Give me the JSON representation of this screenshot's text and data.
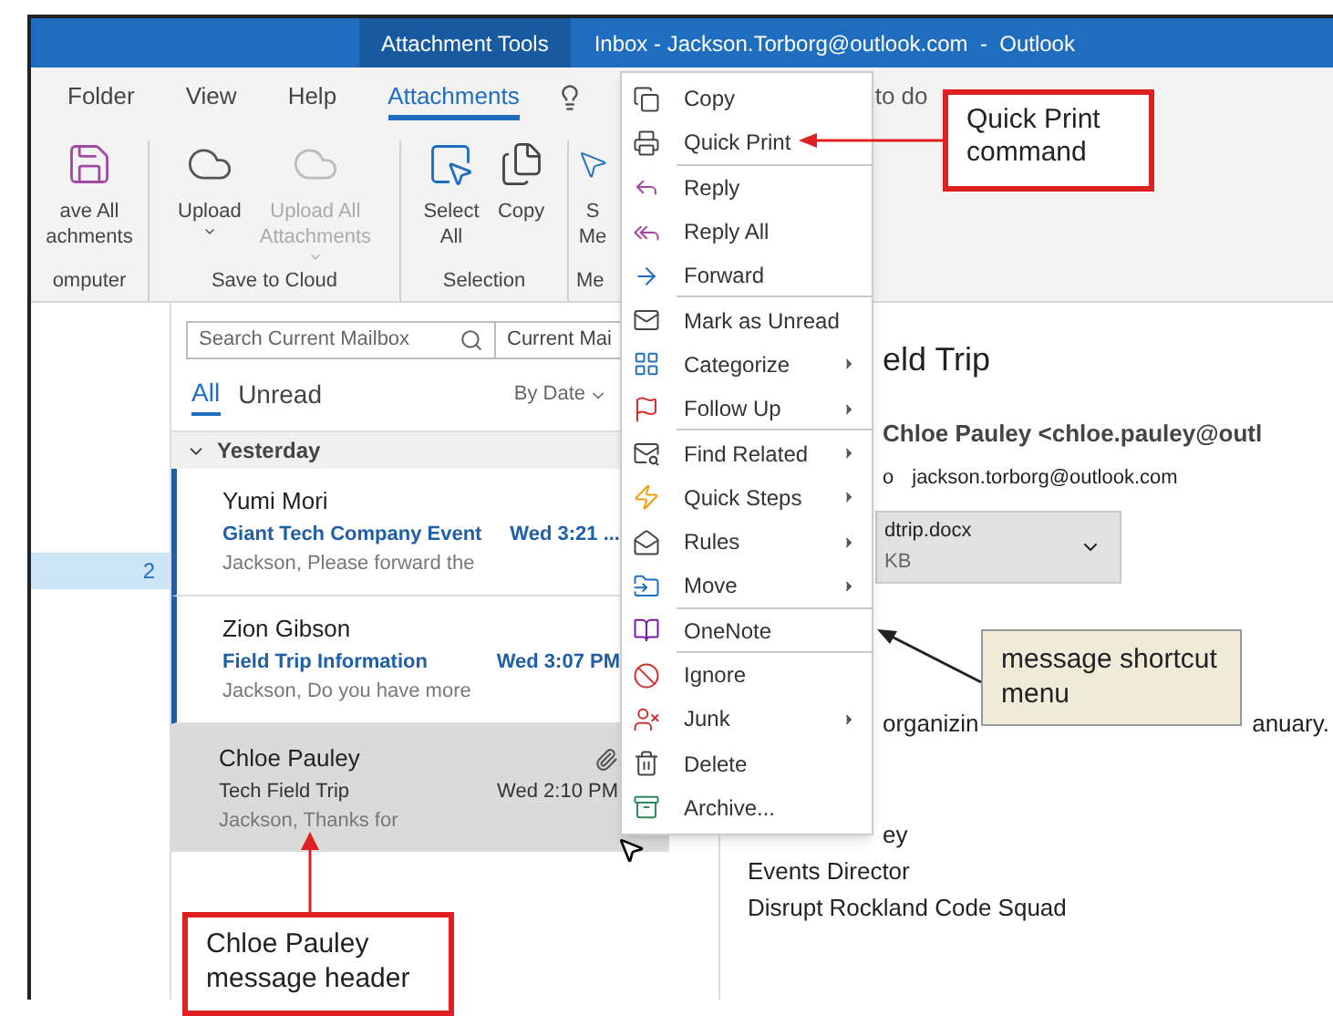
{
  "window": {
    "context_title": "Attachment Tools",
    "title": "Inbox - Jackson.Torborg@outlook.com  -  Outlook"
  },
  "ribbon_tabs": [
    {
      "label": "Folder",
      "selected": false
    },
    {
      "label": "View",
      "selected": false
    },
    {
      "label": "Help",
      "selected": false
    },
    {
      "label": "Attachments",
      "selected": true
    }
  ],
  "tell_me": "to do",
  "ribbon_groups": [
    {
      "label": "omputer",
      "buttons": [
        {
          "label": "ave All\nachments",
          "disabled": false,
          "dropdown": false
        }
      ]
    },
    {
      "label": "Save to Cloud",
      "buttons": [
        {
          "label": "Upload",
          "disabled": false,
          "dropdown": true
        },
        {
          "label": "Upload All\nAttachments",
          "disabled": true,
          "dropdown": true
        }
      ]
    },
    {
      "label": "Selection",
      "buttons": [
        {
          "label": "Select\nAll",
          "disabled": false,
          "dropdown": false
        },
        {
          "label": "Copy",
          "disabled": false,
          "dropdown": false
        }
      ]
    },
    {
      "label": "Me",
      "buttons": [
        {
          "label": "S\nMe",
          "disabled": false,
          "dropdown": false
        }
      ]
    }
  ],
  "folder_pane": {
    "count": "2"
  },
  "message_list": {
    "search_placeholder": "Search Current Mailbox",
    "scope": "Current Mai",
    "filters": [
      {
        "label": "All",
        "selected": true
      },
      {
        "label": "Unread",
        "selected": false
      }
    ],
    "sort": "By Date",
    "group": "Yesterday",
    "messages": [
      {
        "sender": "Yumi Mori",
        "subject": "Giant Tech Company Event",
        "time": "Wed 3:21 ...",
        "preview": "Jackson,  Please forward the",
        "unread": true,
        "selected": false,
        "attachment": false
      },
      {
        "sender": "Zion Gibson",
        "subject": "Field Trip Information",
        "time": "Wed 3:07 PM",
        "preview": "Jackson,  Do you have more",
        "unread": true,
        "selected": false,
        "attachment": false
      },
      {
        "sender": "Chloe Pauley",
        "subject": "Tech Field Trip",
        "time": "Wed 2:10 PM",
        "preview": "Jackson,  Thanks for",
        "unread": false,
        "selected": true,
        "attachment": true
      }
    ]
  },
  "reading_pane": {
    "subject": "eld Trip",
    "from": "Chloe Pauley <chloe.pauley@outl",
    "to_label": "o",
    "to": "jackson.torborg@outlook.com",
    "attachment_name": "dtrip.docx",
    "attachment_size": "KB",
    "body_start": "organizin",
    "body_end": "anuary.",
    "signature": [
      "ey",
      "Events Director",
      "Disrupt Rockland Code Squad"
    ]
  },
  "context_menu": [
    {
      "label": "Copy",
      "submenu": false,
      "separator_after": false
    },
    {
      "label": "Quick Print",
      "submenu": false,
      "separator_after": true
    },
    {
      "label": "Reply",
      "submenu": false,
      "separator_after": false
    },
    {
      "label": "Reply All",
      "submenu": false,
      "separator_after": false
    },
    {
      "label": "Forward",
      "submenu": false,
      "separator_after": true
    },
    {
      "label": "Mark as Unread",
      "submenu": false,
      "separator_after": false
    },
    {
      "label": "Categorize",
      "submenu": true,
      "separator_after": false
    },
    {
      "label": "Follow Up",
      "submenu": true,
      "separator_after": true
    },
    {
      "label": "Find Related",
      "submenu": true,
      "separator_after": false
    },
    {
      "label": "Quick Steps",
      "submenu": true,
      "separator_after": false
    },
    {
      "label": "Rules",
      "submenu": true,
      "separator_after": false
    },
    {
      "label": "Move",
      "submenu": true,
      "separator_after": true
    },
    {
      "label": "OneNote",
      "submenu": false,
      "separator_after": true
    },
    {
      "label": "Ignore",
      "submenu": false,
      "separator_after": false
    },
    {
      "label": "Junk",
      "submenu": true,
      "separator_after": false
    },
    {
      "label": "Delete",
      "submenu": false,
      "separator_after": false
    },
    {
      "label": "Archive...",
      "submenu": false,
      "separator_after": false
    }
  ],
  "callouts": {
    "quick_print": "Quick Print command",
    "shortcut_menu": "message shortcut menu",
    "message_header": "Chloe Pauley message header"
  }
}
